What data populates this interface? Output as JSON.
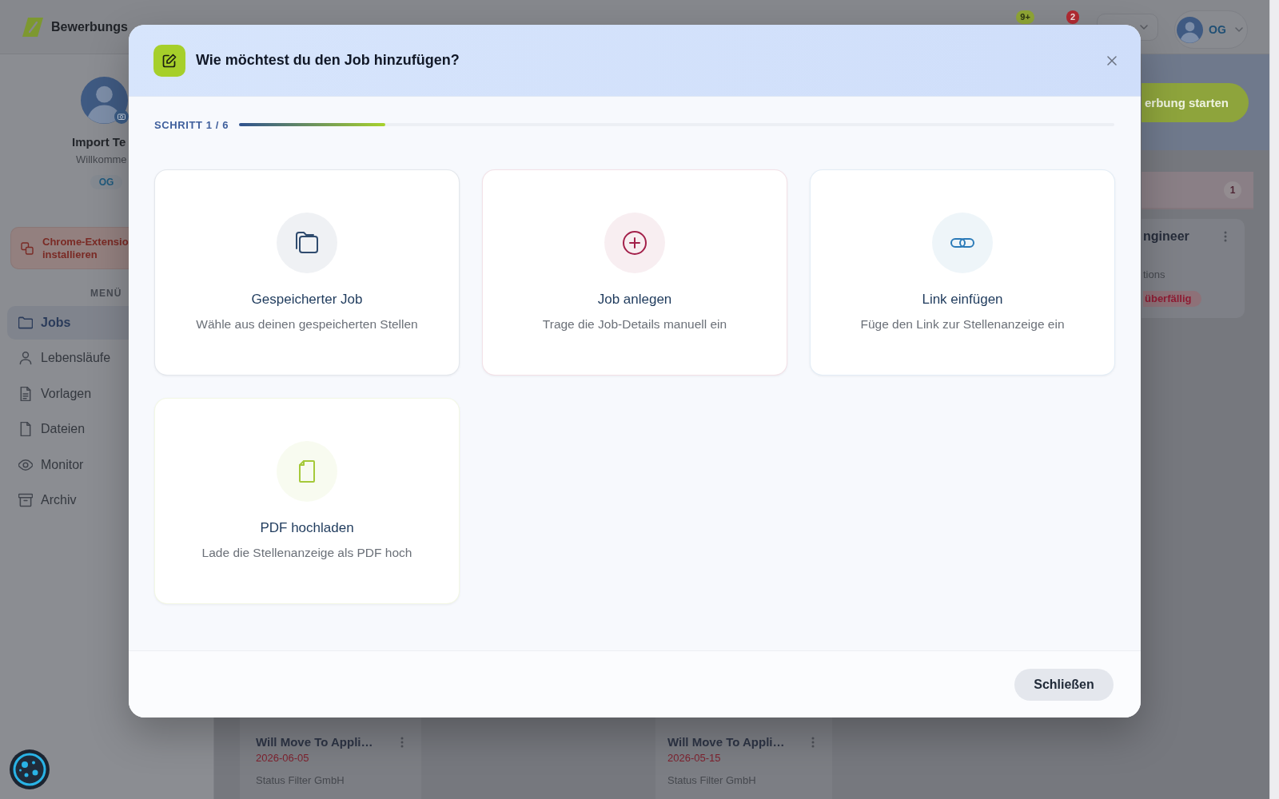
{
  "header": {
    "logo": "Bewerbungs",
    "badges": [
      {
        "text": "9+",
        "color": "#8fa535"
      },
      {
        "text": "2",
        "color": "#b02a32"
      }
    ],
    "user_menu": {
      "initials": "OG"
    }
  },
  "sidebar": {
    "profile": {
      "name": "Import Te",
      "greeting": "Willkomme",
      "initials": "OG"
    },
    "extension_banner": {
      "lines": [
        "Chrome-Extensio",
        "installieren"
      ]
    },
    "menu_label": "MENÜ",
    "items": [
      {
        "label": "Jobs",
        "kind": "jobs",
        "selected": true
      },
      {
        "label": "Lebensläufe",
        "kind": "resumes",
        "selected": false
      },
      {
        "label": "Vorlagen",
        "kind": "templates",
        "selected": false
      },
      {
        "label": "Dateien",
        "kind": "files",
        "selected": false
      },
      {
        "label": "Monitor",
        "kind": "monitor",
        "selected": false
      },
      {
        "label": "Archiv",
        "kind": "archive",
        "selected": false
      }
    ]
  },
  "board": {
    "start_button": "erbung starten",
    "column": {
      "count": "1",
      "card": {
        "title": "ngineer",
        "company": "tions",
        "tag": "überfällig"
      }
    },
    "bottom_cards": [
      {
        "title": "Will Move To Appli…",
        "date": "2026-06-05",
        "company": "Status Filter GmbH"
      },
      {
        "title": "Will Move To Appli…",
        "date": "2026-05-15",
        "company": "Status Filter GmbH"
      }
    ]
  },
  "modal": {
    "title": "Wie möchtest du den Job hinzufügen?",
    "step": {
      "label": "SCHRITT 1 / 6",
      "level": 0.1667
    },
    "options": [
      {
        "kind": "saved",
        "title": "Gespeicherter Job",
        "description": "Wähle aus deinen gespeicherten Stellen",
        "color": "#2f4b6e"
      },
      {
        "kind": "manual",
        "title": "Job anlegen",
        "description": "Trage die Job-Details manuell ein",
        "color": "#a3204a"
      },
      {
        "kind": "link",
        "title": "Link einfügen",
        "description": "Füge den Link zur Stellenanzeige ein",
        "color": "#2a7ab8"
      },
      {
        "kind": "pdf",
        "title": "PDF hochladen",
        "description": "Lade die Stellenanzeige als PDF hoch",
        "color": "#a5c93a"
      }
    ],
    "close_button": "Schließen"
  }
}
